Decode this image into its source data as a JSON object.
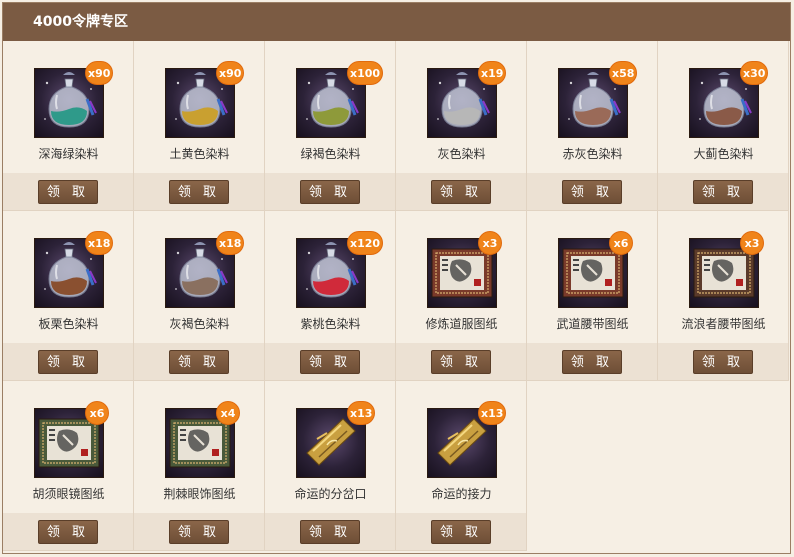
{
  "section": {
    "title": "4000令牌专区"
  },
  "claim_label": "领 取",
  "items": [
    {
      "name": "深海绿染料",
      "count": "x90",
      "icon": "dye-bottle-icon",
      "color": "#2f9a8a"
    },
    {
      "name": "土黄色染料",
      "count": "x90",
      "icon": "dye-bottle-icon",
      "color": "#c9a030"
    },
    {
      "name": "绿褐色染料",
      "count": "x100",
      "icon": "dye-bottle-icon",
      "color": "#8e9a3a"
    },
    {
      "name": "灰色染料",
      "count": "x19",
      "icon": "dye-bottle-icon",
      "color": "#b7b7b7"
    },
    {
      "name": "赤灰色染料",
      "count": "x58",
      "icon": "dye-bottle-icon",
      "color": "#9a6a58"
    },
    {
      "name": "大蓟色染料",
      "count": "x30",
      "icon": "dye-bottle-icon",
      "color": "#8a5a48"
    },
    {
      "name": "板栗色染料",
      "count": "x18",
      "icon": "dye-bottle-icon",
      "color": "#8a5030"
    },
    {
      "name": "灰褐色染料",
      "count": "x18",
      "icon": "dye-bottle-icon",
      "color": "#8a7060"
    },
    {
      "name": "紫桃色染料",
      "count": "x120",
      "icon": "dye-bottle-icon",
      "color": "#d02a3a"
    },
    {
      "name": "修炼道服图纸",
      "count": "x3",
      "icon": "pattern-scroll-icon",
      "color": "#7a3a2a"
    },
    {
      "name": "武道腰带图纸",
      "count": "x6",
      "icon": "pattern-scroll-icon",
      "color": "#7a3a2a"
    },
    {
      "name": "流浪者腰带图纸",
      "count": "x3",
      "icon": "pattern-scroll-icon",
      "color": "#5a3a2a"
    },
    {
      "name": "胡须眼镜图纸",
      "count": "x6",
      "icon": "pattern-scroll-icon",
      "color": "#4a5a3a"
    },
    {
      "name": "荆棘眼饰图纸",
      "count": "x4",
      "icon": "pattern-scroll-icon",
      "color": "#4a5a3a"
    },
    {
      "name": "命运的分岔口",
      "count": "x13",
      "icon": "gold-rune-icon",
      "color": "#c9a040"
    },
    {
      "name": "命运的接力",
      "count": "x13",
      "icon": "gold-rune-icon",
      "color": "#c9a040"
    }
  ]
}
